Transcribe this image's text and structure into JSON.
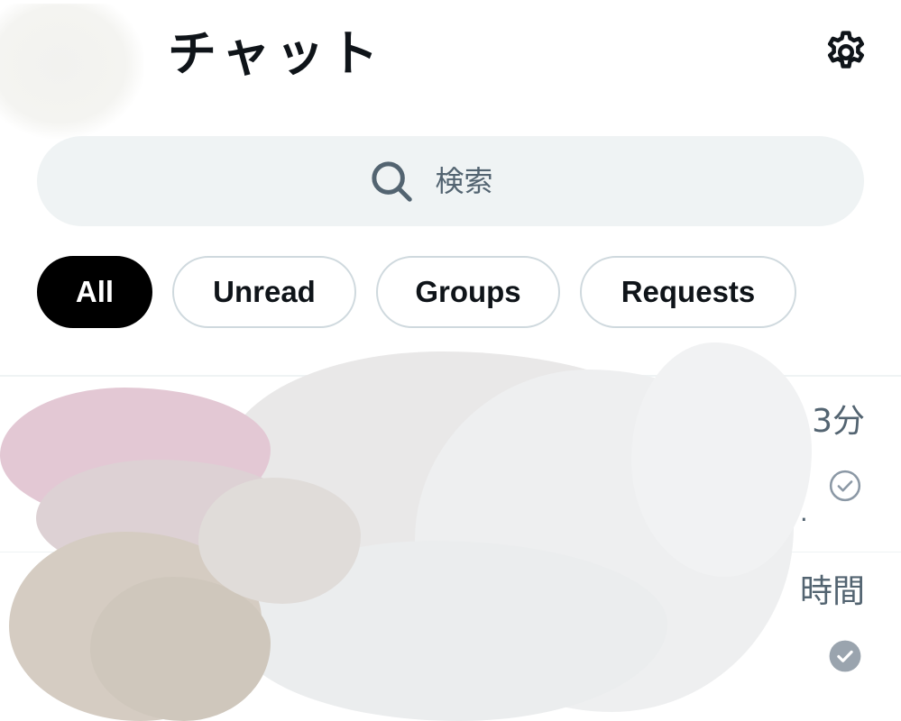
{
  "header": {
    "title": "チャット",
    "settings_icon": "gear-icon"
  },
  "search": {
    "icon": "search-icon",
    "placeholder": "検索"
  },
  "filters": {
    "items": [
      {
        "label": "All",
        "active": true
      },
      {
        "label": "Unread",
        "active": false
      },
      {
        "label": "Groups",
        "active": false
      },
      {
        "label": "Requests",
        "active": false
      }
    ]
  },
  "conversations": [
    {
      "time": "3分",
      "preview_tail": "…",
      "status": "sent-check-outline"
    },
    {
      "time": "時間",
      "status": "read-check-filled"
    }
  ],
  "colors": {
    "text_primary": "#0f1419",
    "text_secondary": "#536471",
    "search_bg": "#eff3f4",
    "chip_border": "#cfd9de",
    "active_chip": "#000000"
  }
}
